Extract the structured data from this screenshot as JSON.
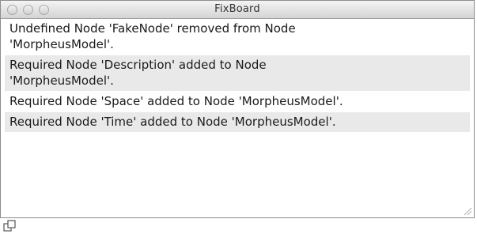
{
  "window": {
    "title": "FixBoard"
  },
  "messages": [
    {
      "text": "Undefined Node 'FakeNode' removed from Node 'MorpheusModel'."
    },
    {
      "text": "Required Node 'Description' added to Node 'MorpheusModel'."
    },
    {
      "text": "Required Node 'Space' added to Node 'MorpheusModel'."
    },
    {
      "text": "Required Node 'Time' added to Node 'MorpheusModel'."
    }
  ],
  "icons": {
    "close": "close-button-icon",
    "minimize": "minimize-button-icon",
    "zoom": "zoom-button-icon",
    "resize": "resize-grip-icon",
    "below": "window-layout-icon"
  }
}
